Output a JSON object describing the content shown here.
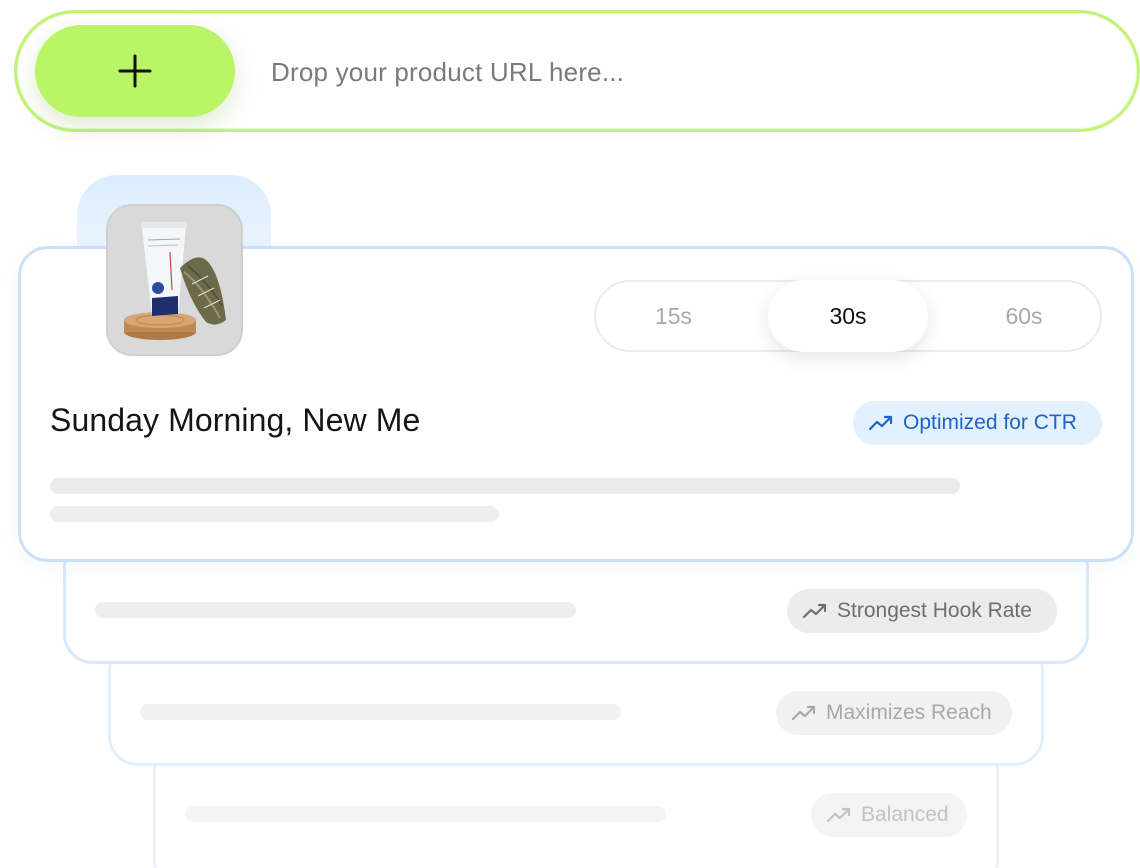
{
  "url_bar": {
    "add_button_icon": "plus-icon",
    "placeholder": "Drop your product URL here...",
    "value": ""
  },
  "product": {
    "thumbnail_icon": "product-image",
    "title": "Sunday Morning, New Me"
  },
  "duration_options": [
    {
      "label": "15s",
      "selected": false
    },
    {
      "label": "30s",
      "selected": true
    },
    {
      "label": "60s",
      "selected": false
    }
  ],
  "variants": [
    {
      "badge": "Optimized for CTR",
      "icon": "trending-up-icon",
      "accent": "#1f63c7"
    },
    {
      "badge": "Strongest Hook Rate",
      "icon": "trending-up-icon",
      "accent": "#6e6e6e"
    },
    {
      "badge": "Maximizes Reach",
      "icon": "trending-up-icon",
      "accent": "#a8a8a8"
    },
    {
      "badge": "Balanced",
      "icon": "trending-up-icon",
      "accent": "#c3c3c3"
    }
  ],
  "colors": {
    "accent_green": "#b9f566",
    "card_border": "#c9e1f8",
    "badge_blue_bg": "#e3f0fd"
  }
}
